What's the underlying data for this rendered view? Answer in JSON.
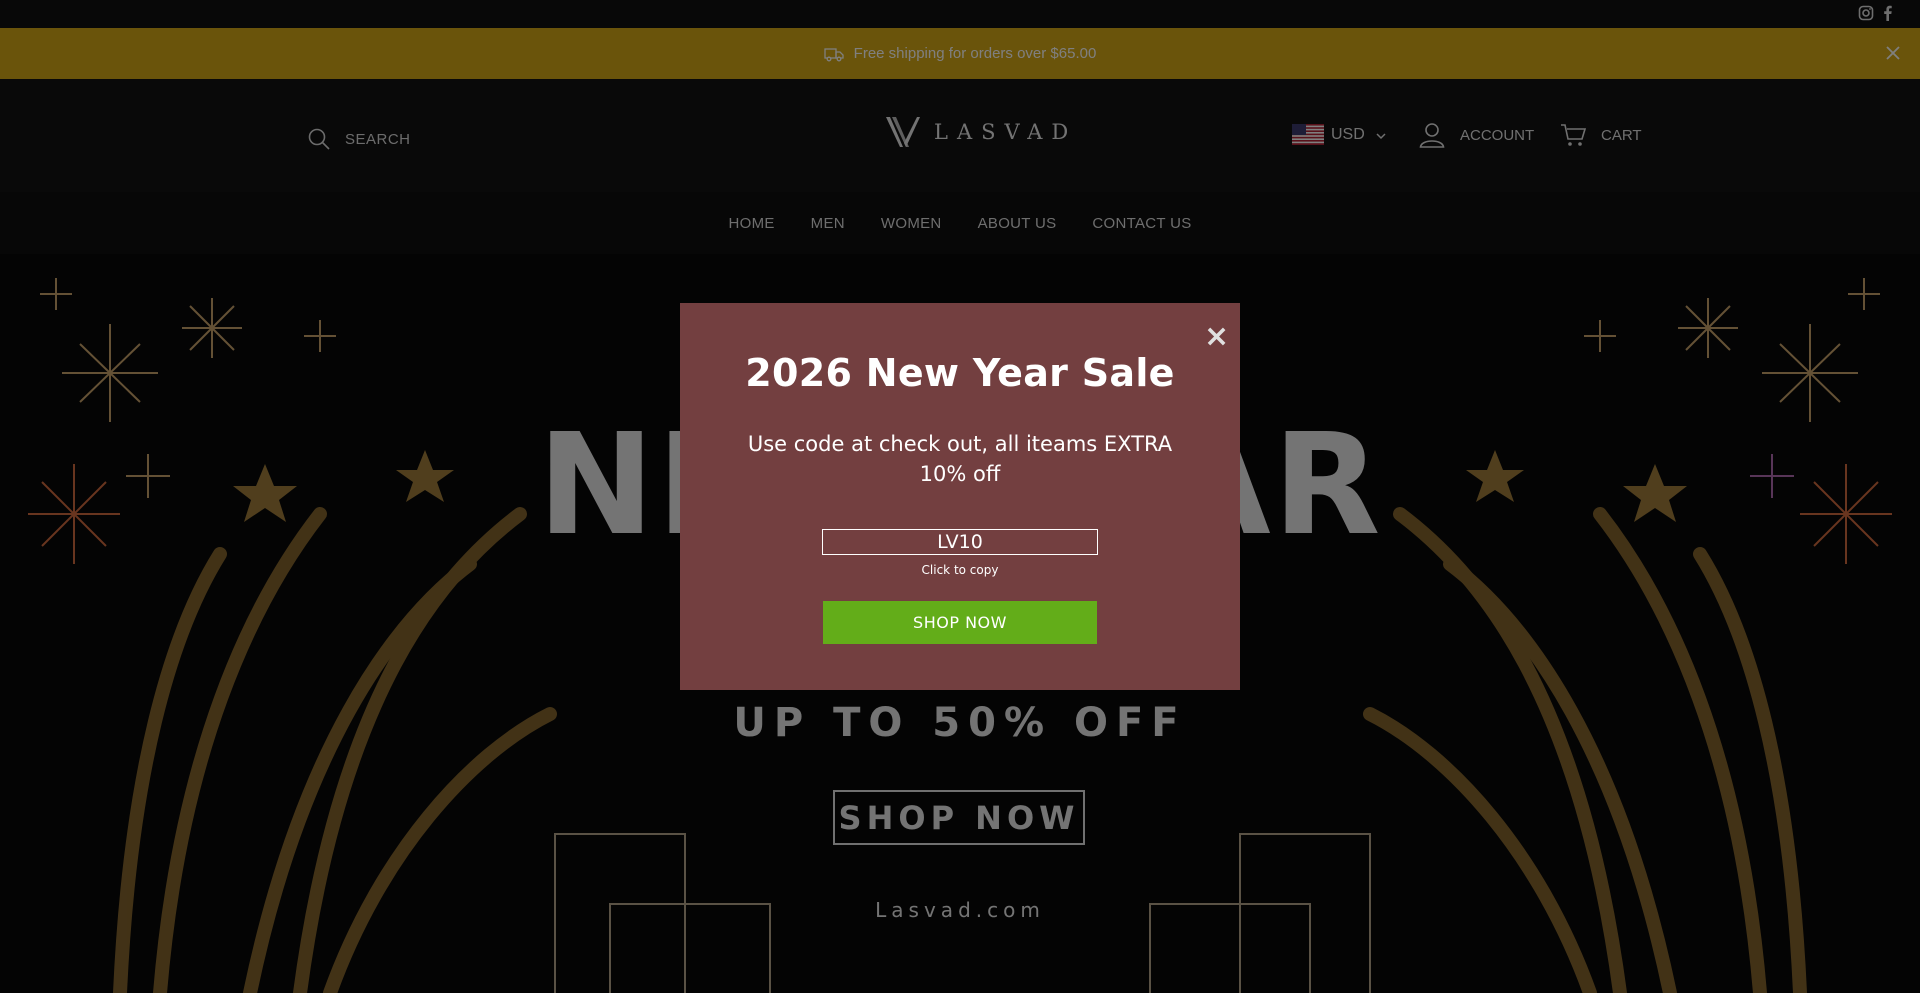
{
  "topbar": {
    "social": [
      {
        "name": "instagram-icon"
      },
      {
        "name": "facebook-icon"
      }
    ]
  },
  "announcement": {
    "text": "Free shipping for orders over $65.00",
    "bg_color": "#d4a817"
  },
  "header": {
    "search_label": "SEARCH",
    "logo_text": "LASVAD",
    "currency": "USD",
    "account_label": "ACCOUNT",
    "cart_label": "CART"
  },
  "nav": {
    "items": [
      "HOME",
      "MEN",
      "WOMEN",
      "ABOUT US",
      "CONTACT US"
    ]
  },
  "hero": {
    "title": "NEW YEAR",
    "subtitle": "UP TO 50% OFF",
    "button_label": "SHOP NOW",
    "site": "Lasvad.com"
  },
  "modal": {
    "title": "2026 New Year Sale",
    "description": "Use code at check out, all iteams EXTRA 10% off",
    "code": "LV10",
    "copy_hint": "Click to copy",
    "button_label": "SHOP NOW",
    "bg_color": "#733f40",
    "button_color": "#63ad19"
  }
}
